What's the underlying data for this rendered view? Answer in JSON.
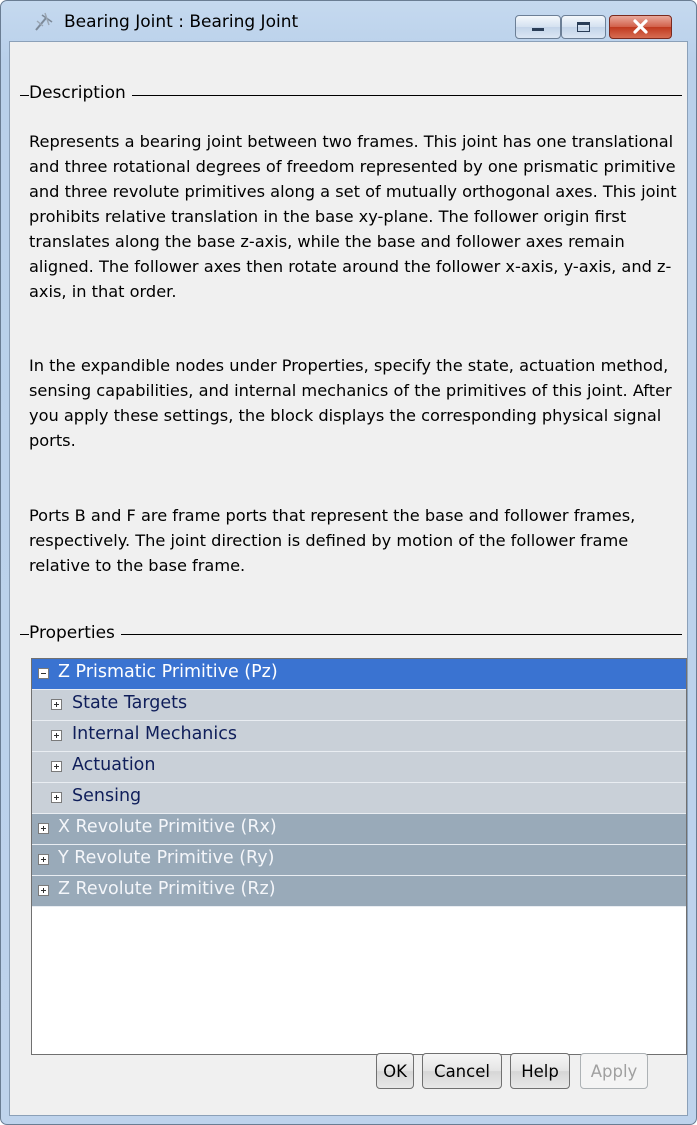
{
  "window": {
    "title": "Bearing Joint : Bearing Joint"
  },
  "description": {
    "group_label": "Description",
    "paragraphs": [
      "Represents a bearing joint between two frames. This joint has one translational and three rotational degrees of freedom represented by one prismatic primitive and three revolute primitives along a set of mutually orthogonal axes. This joint prohibits relative translation in the base xy-plane. The follower origin first translates along the base z-axis, while the base and follower axes remain aligned. The follower axes then rotate around the follower x-axis, y-axis, and z-axis, in that order.",
      "In the expandible nodes under Properties, specify the state, actuation method, sensing capabilities, and internal mechanics of the primitives of this joint. After you apply these settings, the block displays the corresponding physical signal ports.",
      "Ports B and F are frame ports that represent the base and follower frames, respectively. The joint direction is defined by motion of the follower frame relative to the base frame."
    ]
  },
  "properties": {
    "group_label": "Properties",
    "tree": [
      {
        "label": "Z Prismatic Primitive (Pz)",
        "level": 0,
        "expanded": true,
        "selected": true
      },
      {
        "label": "State Targets",
        "level": 1,
        "expanded": false
      },
      {
        "label": "Internal Mechanics",
        "level": 1,
        "expanded": false
      },
      {
        "label": "Actuation",
        "level": 1,
        "expanded": false
      },
      {
        "label": "Sensing",
        "level": 1,
        "expanded": false
      },
      {
        "label": "X Revolute Primitive (Rx)",
        "level": 0,
        "expanded": false
      },
      {
        "label": "Y Revolute Primitive (Ry)",
        "level": 0,
        "expanded": false
      },
      {
        "label": "Z Revolute Primitive (Rz)",
        "level": 0,
        "expanded": false
      }
    ]
  },
  "buttons": {
    "ok": "OK",
    "cancel": "Cancel",
    "help": "Help",
    "apply": "Apply"
  },
  "colors": {
    "selected_row": "#3a73d1",
    "child_row": "#c9d0d8",
    "collapsed_parent_row": "#99aab9"
  }
}
